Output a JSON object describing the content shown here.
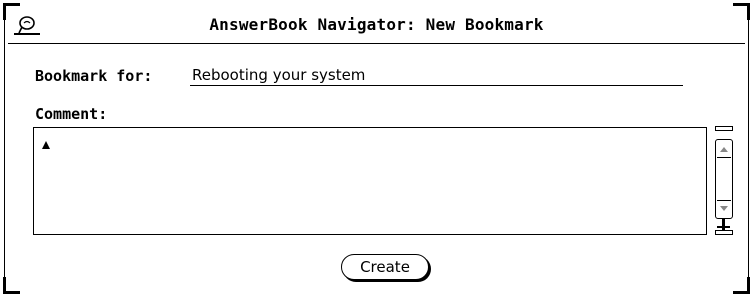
{
  "window": {
    "title": "AnswerBook Navigator: New Bookmark",
    "menu_icon": "window-menu-icon"
  },
  "form": {
    "bookmark_label": "Bookmark for:",
    "bookmark_value": "Rebooting your system",
    "comment_label": "Comment:",
    "comment_value": ""
  },
  "scrollbar": {
    "up_icon": "scroll-up-arrow-icon",
    "down_icon": "scroll-down-arrow-icon"
  },
  "actions": {
    "create_label": "Create"
  }
}
